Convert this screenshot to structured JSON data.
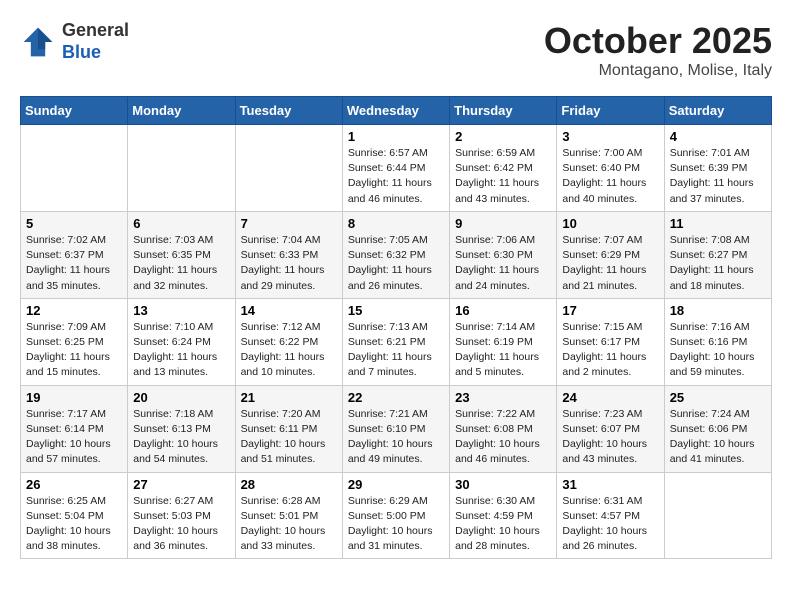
{
  "header": {
    "logo_line1": "General",
    "logo_line2": "Blue",
    "month": "October 2025",
    "location": "Montagano, Molise, Italy"
  },
  "weekdays": [
    "Sunday",
    "Monday",
    "Tuesday",
    "Wednesday",
    "Thursday",
    "Friday",
    "Saturday"
  ],
  "weeks": [
    [
      {
        "day": "",
        "info": ""
      },
      {
        "day": "",
        "info": ""
      },
      {
        "day": "",
        "info": ""
      },
      {
        "day": "1",
        "info": "Sunrise: 6:57 AM\nSunset: 6:44 PM\nDaylight: 11 hours\nand 46 minutes."
      },
      {
        "day": "2",
        "info": "Sunrise: 6:59 AM\nSunset: 6:42 PM\nDaylight: 11 hours\nand 43 minutes."
      },
      {
        "day": "3",
        "info": "Sunrise: 7:00 AM\nSunset: 6:40 PM\nDaylight: 11 hours\nand 40 minutes."
      },
      {
        "day": "4",
        "info": "Sunrise: 7:01 AM\nSunset: 6:39 PM\nDaylight: 11 hours\nand 37 minutes."
      }
    ],
    [
      {
        "day": "5",
        "info": "Sunrise: 7:02 AM\nSunset: 6:37 PM\nDaylight: 11 hours\nand 35 minutes."
      },
      {
        "day": "6",
        "info": "Sunrise: 7:03 AM\nSunset: 6:35 PM\nDaylight: 11 hours\nand 32 minutes."
      },
      {
        "day": "7",
        "info": "Sunrise: 7:04 AM\nSunset: 6:33 PM\nDaylight: 11 hours\nand 29 minutes."
      },
      {
        "day": "8",
        "info": "Sunrise: 7:05 AM\nSunset: 6:32 PM\nDaylight: 11 hours\nand 26 minutes."
      },
      {
        "day": "9",
        "info": "Sunrise: 7:06 AM\nSunset: 6:30 PM\nDaylight: 11 hours\nand 24 minutes."
      },
      {
        "day": "10",
        "info": "Sunrise: 7:07 AM\nSunset: 6:29 PM\nDaylight: 11 hours\nand 21 minutes."
      },
      {
        "day": "11",
        "info": "Sunrise: 7:08 AM\nSunset: 6:27 PM\nDaylight: 11 hours\nand 18 minutes."
      }
    ],
    [
      {
        "day": "12",
        "info": "Sunrise: 7:09 AM\nSunset: 6:25 PM\nDaylight: 11 hours\nand 15 minutes."
      },
      {
        "day": "13",
        "info": "Sunrise: 7:10 AM\nSunset: 6:24 PM\nDaylight: 11 hours\nand 13 minutes."
      },
      {
        "day": "14",
        "info": "Sunrise: 7:12 AM\nSunset: 6:22 PM\nDaylight: 11 hours\nand 10 minutes."
      },
      {
        "day": "15",
        "info": "Sunrise: 7:13 AM\nSunset: 6:21 PM\nDaylight: 11 hours\nand 7 minutes."
      },
      {
        "day": "16",
        "info": "Sunrise: 7:14 AM\nSunset: 6:19 PM\nDaylight: 11 hours\nand 5 minutes."
      },
      {
        "day": "17",
        "info": "Sunrise: 7:15 AM\nSunset: 6:17 PM\nDaylight: 11 hours\nand 2 minutes."
      },
      {
        "day": "18",
        "info": "Sunrise: 7:16 AM\nSunset: 6:16 PM\nDaylight: 10 hours\nand 59 minutes."
      }
    ],
    [
      {
        "day": "19",
        "info": "Sunrise: 7:17 AM\nSunset: 6:14 PM\nDaylight: 10 hours\nand 57 minutes."
      },
      {
        "day": "20",
        "info": "Sunrise: 7:18 AM\nSunset: 6:13 PM\nDaylight: 10 hours\nand 54 minutes."
      },
      {
        "day": "21",
        "info": "Sunrise: 7:20 AM\nSunset: 6:11 PM\nDaylight: 10 hours\nand 51 minutes."
      },
      {
        "day": "22",
        "info": "Sunrise: 7:21 AM\nSunset: 6:10 PM\nDaylight: 10 hours\nand 49 minutes."
      },
      {
        "day": "23",
        "info": "Sunrise: 7:22 AM\nSunset: 6:08 PM\nDaylight: 10 hours\nand 46 minutes."
      },
      {
        "day": "24",
        "info": "Sunrise: 7:23 AM\nSunset: 6:07 PM\nDaylight: 10 hours\nand 43 minutes."
      },
      {
        "day": "25",
        "info": "Sunrise: 7:24 AM\nSunset: 6:06 PM\nDaylight: 10 hours\nand 41 minutes."
      }
    ],
    [
      {
        "day": "26",
        "info": "Sunrise: 6:25 AM\nSunset: 5:04 PM\nDaylight: 10 hours\nand 38 minutes."
      },
      {
        "day": "27",
        "info": "Sunrise: 6:27 AM\nSunset: 5:03 PM\nDaylight: 10 hours\nand 36 minutes."
      },
      {
        "day": "28",
        "info": "Sunrise: 6:28 AM\nSunset: 5:01 PM\nDaylight: 10 hours\nand 33 minutes."
      },
      {
        "day": "29",
        "info": "Sunrise: 6:29 AM\nSunset: 5:00 PM\nDaylight: 10 hours\nand 31 minutes."
      },
      {
        "day": "30",
        "info": "Sunrise: 6:30 AM\nSunset: 4:59 PM\nDaylight: 10 hours\nand 28 minutes."
      },
      {
        "day": "31",
        "info": "Sunrise: 6:31 AM\nSunset: 4:57 PM\nDaylight: 10 hours\nand 26 minutes."
      },
      {
        "day": "",
        "info": ""
      }
    ]
  ]
}
